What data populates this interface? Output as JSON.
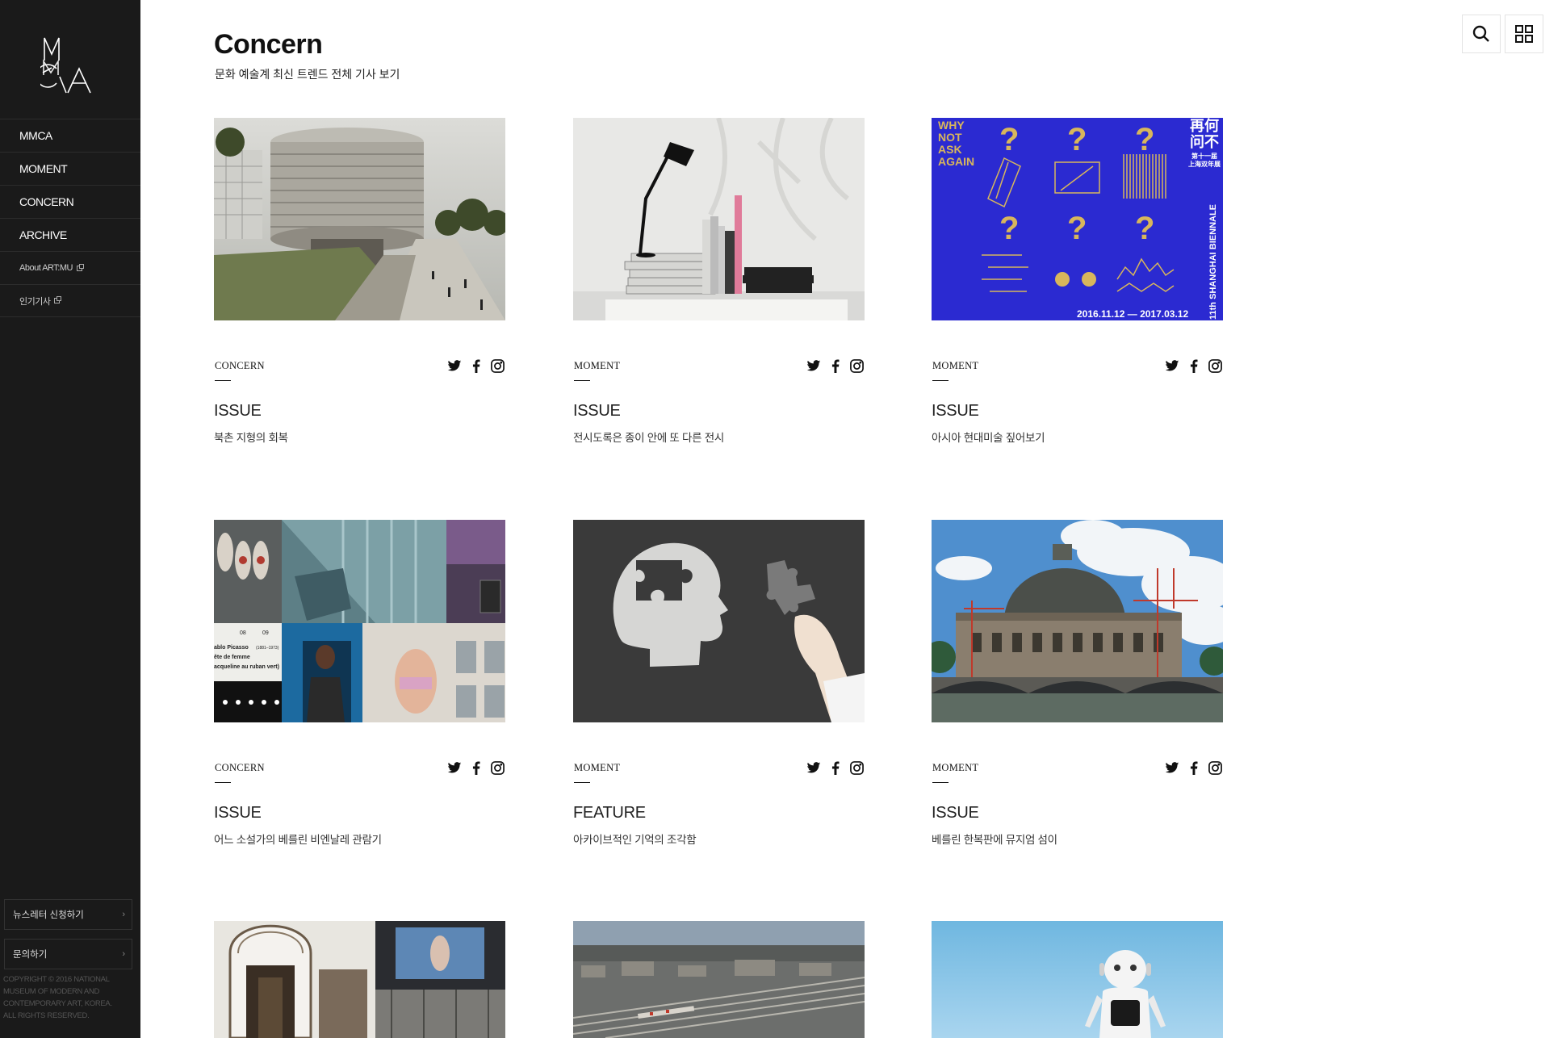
{
  "sidebar": {
    "logo_text": "MMCA",
    "nav": [
      {
        "label": "MMCA",
        "external": false
      },
      {
        "label": "MOMENT",
        "external": false
      },
      {
        "label": "CONCERN",
        "external": false
      },
      {
        "label": "ARCHIVE",
        "external": false
      },
      {
        "label": "About ART:MU",
        "external": true
      },
      {
        "label": "인기기사",
        "external": true
      }
    ],
    "newsletter_label": "뉴스레터 신청하기",
    "contact_label": "문의하기",
    "chevron": "›",
    "copyright": "COPYRIGHT © 2016 NATIONAL MUSEUM OF MODERN AND CONTEMPORARY ART, KOREA. ALL RIGHTS RESERVED."
  },
  "header": {
    "title": "Concern",
    "subtitle": "문화 예술계 최신 트렌드 전체 기사 보기",
    "search_icon": "search-icon",
    "grid_icon": "grid-view-icon"
  },
  "cards": [
    {
      "category": "CONCERN",
      "kind": "ISSUE",
      "headline": "북촌 지형의 회복",
      "image": "architecture-rendering"
    },
    {
      "category": "MOMENT",
      "kind": "ISSUE",
      "headline": "전시도록은 종이 안에 또 다른 전시",
      "image": "desk-lamp-books"
    },
    {
      "category": "MOMENT",
      "kind": "ISSUE",
      "headline": "아시아 현대미술 짚어보기",
      "image": "shanghai-biennale-poster",
      "poster": {
        "left_text": [
          "WHY",
          "NOT",
          "ASK",
          "AGAIN"
        ],
        "cjk": [
          "再何",
          "问不"
        ],
        "edition": "第十一届",
        "city": "上海双年展",
        "vertical": "11th SHANGHAI BIENNALE",
        "dates": "2016.11.12 — 2017.03.12"
      }
    },
    {
      "category": "CONCERN",
      "kind": "ISSUE",
      "headline": "어느 소설가의 베를린 비엔날레 관람기",
      "image": "biennale-collage",
      "collage_text": [
        "08",
        "09",
        "ablo Picasso",
        "(1881–1973)",
        "ête de femme",
        "acqueline au ruban vert)"
      ]
    },
    {
      "category": "MOMENT",
      "kind": "FEATURE",
      "headline": "아카이브적인 기억의 조각함",
      "image": "puzzle-head"
    },
    {
      "category": "MOMENT",
      "kind": "ISSUE",
      "headline": "베를린 한복판에 뮤지엄 섬이",
      "image": "bode-museum"
    },
    {
      "image": "museum-interior"
    },
    {
      "image": "city-aerial"
    },
    {
      "image": "robot"
    }
  ],
  "share_icons": [
    "twitter-icon",
    "facebook-icon",
    "instagram-icon"
  ],
  "colors": {
    "sidebar_bg": "#1a1a1a",
    "poster_blue": "#2b2ad1",
    "poster_gold": "#d8b65c"
  }
}
